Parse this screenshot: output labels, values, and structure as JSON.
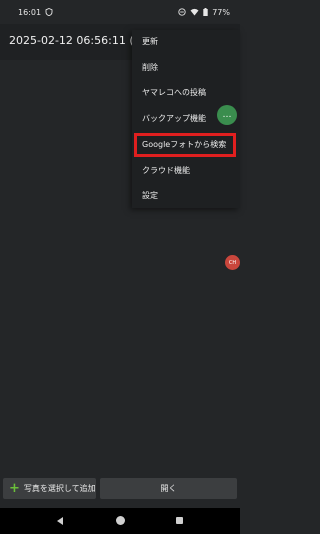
{
  "status": {
    "time": "16:01",
    "battery": "77%"
  },
  "title": "2025-02-12 06:56:11 (0)",
  "menu": {
    "items": [
      "更新",
      "削除",
      "ヤマレコへの投稿",
      "バックアップ機能",
      "Googleフォトから検索",
      "クラウド機能",
      "設定"
    ]
  },
  "fab": {
    "label": "…"
  },
  "side_tab": {
    "label": "CH"
  },
  "bottom": {
    "add_label": "写真を選択して追加",
    "open_label": "開く"
  },
  "colors": {
    "highlight": "#e01f1f",
    "fab": "#3a8d4e",
    "plus": "#6bbf3a"
  }
}
